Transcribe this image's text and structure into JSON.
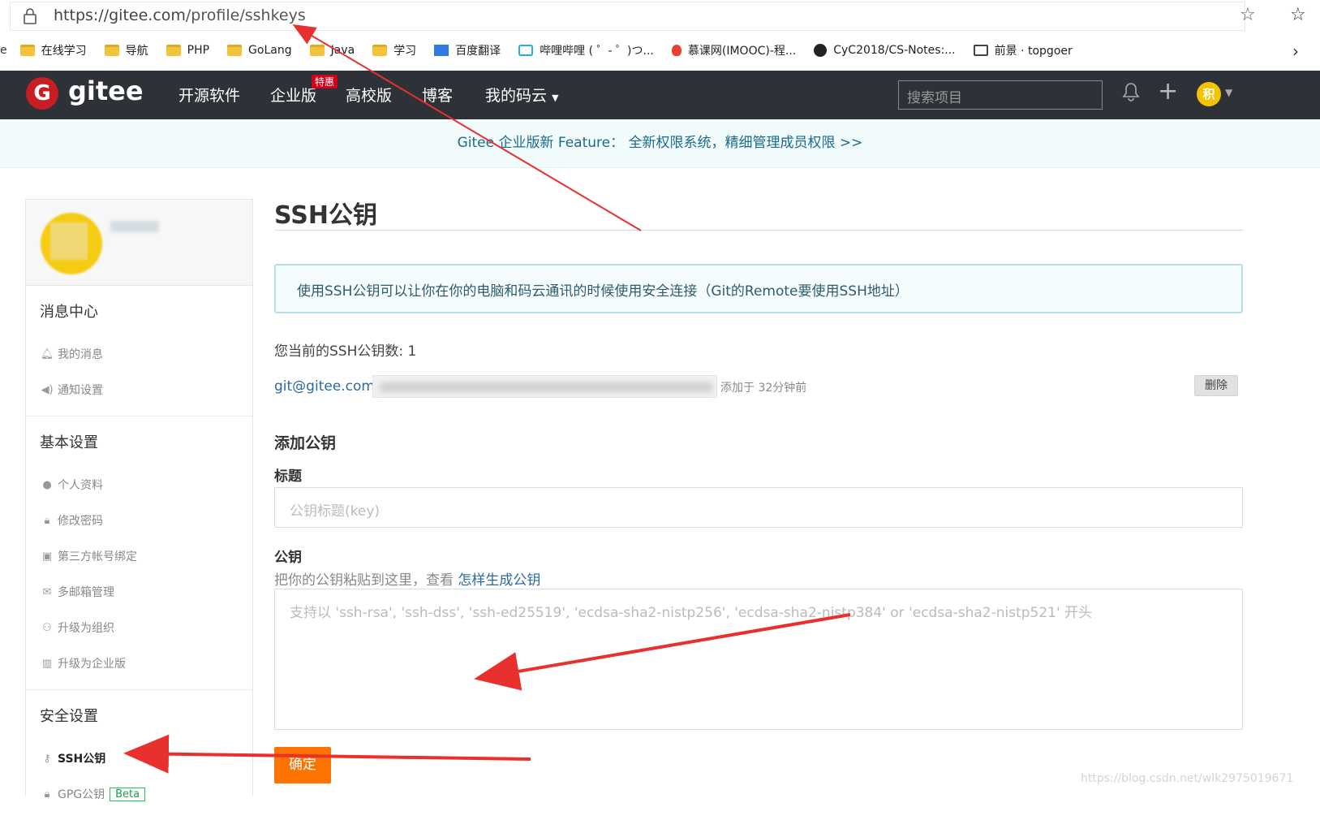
{
  "browser": {
    "url_host": "https://gitee.com",
    "url_path": "/profile/sshkeys",
    "bookmarks": [
      {
        "label": "在线学习",
        "icon": "folder-icon"
      },
      {
        "label": "导航",
        "icon": "folder-icon"
      },
      {
        "label": "PHP",
        "icon": "folder-icon"
      },
      {
        "label": "GoLang",
        "icon": "folder-icon"
      },
      {
        "label": "Java",
        "icon": "folder-icon"
      },
      {
        "label": "学习",
        "icon": "folder-icon"
      },
      {
        "label": "百度翻译",
        "icon": "translate-icon"
      },
      {
        "label": "哔哩哔哩 ( ゜- ゜)つ...",
        "icon": "bilibili-icon"
      },
      {
        "label": "慕课网(IMOOC)-程...",
        "icon": "flame-icon"
      },
      {
        "label": "CyC2018/CS-Notes:...",
        "icon": "github-icon"
      },
      {
        "label": "前景 · topgoer",
        "icon": "book-icon"
      }
    ]
  },
  "header": {
    "logo_letter": "G",
    "logo_text": "gitee",
    "nav": [
      "开源软件",
      "企业版",
      "高校版",
      "博客",
      "我的码云"
    ],
    "badge": "特惠",
    "search_placeholder": "搜索项目",
    "avatar_letter": "积"
  },
  "banner": "Gitee 企业版新 Feature： 全新权限系统，精细管理成员权限 >>",
  "sidebar": {
    "sections": [
      {
        "title": "消息中心",
        "items": [
          {
            "label": "我的消息",
            "icon": "bell-icon"
          },
          {
            "label": "通知设置",
            "icon": "speaker-icon"
          }
        ]
      },
      {
        "title": "基本设置",
        "items": [
          {
            "label": "个人资料",
            "icon": "user-icon"
          },
          {
            "label": "修改密码",
            "icon": "lock-icon"
          },
          {
            "label": "第三方帐号绑定",
            "icon": "bind-icon"
          },
          {
            "label": "多邮箱管理",
            "icon": "mail-icon"
          },
          {
            "label": "升级为组织",
            "icon": "group-icon"
          },
          {
            "label": "升级为企业版",
            "icon": "building-icon"
          }
        ]
      },
      {
        "title": "安全设置",
        "items": [
          {
            "label": "SSH公钥",
            "icon": "key-icon"
          },
          {
            "label": "GPG公钥",
            "icon": "lock-icon"
          }
        ]
      }
    ],
    "beta": "Beta"
  },
  "main": {
    "title": "SSH公钥",
    "info": "使用SSH公钥可以让你在你的电脑和码云通讯的时候使用安全连接（Git的Remote要使用SSH地址）",
    "count_label": "您当前的SSH公钥数: 1",
    "key_name": "git@gitee.com",
    "key_time": "添加于 32分钟前",
    "delete_label": "删除",
    "add_heading": "添加公钥",
    "title_label": "标题",
    "title_placeholder": "公钥标题(key)",
    "key_label": "公钥",
    "key_hint": "把你的公钥粘贴到这里，查看",
    "key_hint_link": "怎样生成公钥",
    "key_placeholder": "支持以 'ssh-rsa', 'ssh-dss', 'ssh-ed25519', 'ecdsa-sha2-nistp256', 'ecdsa-sha2-nistp384' or 'ecdsa-sha2-nistp521' 开头",
    "submit_label": "确定"
  },
  "watermark": "https://blog.csdn.net/wlk2975019671",
  "colors": {
    "header_bg": "#2e3138",
    "accent": "#fe7300",
    "logo": "#c71d23",
    "annotation": "#e8312e"
  }
}
